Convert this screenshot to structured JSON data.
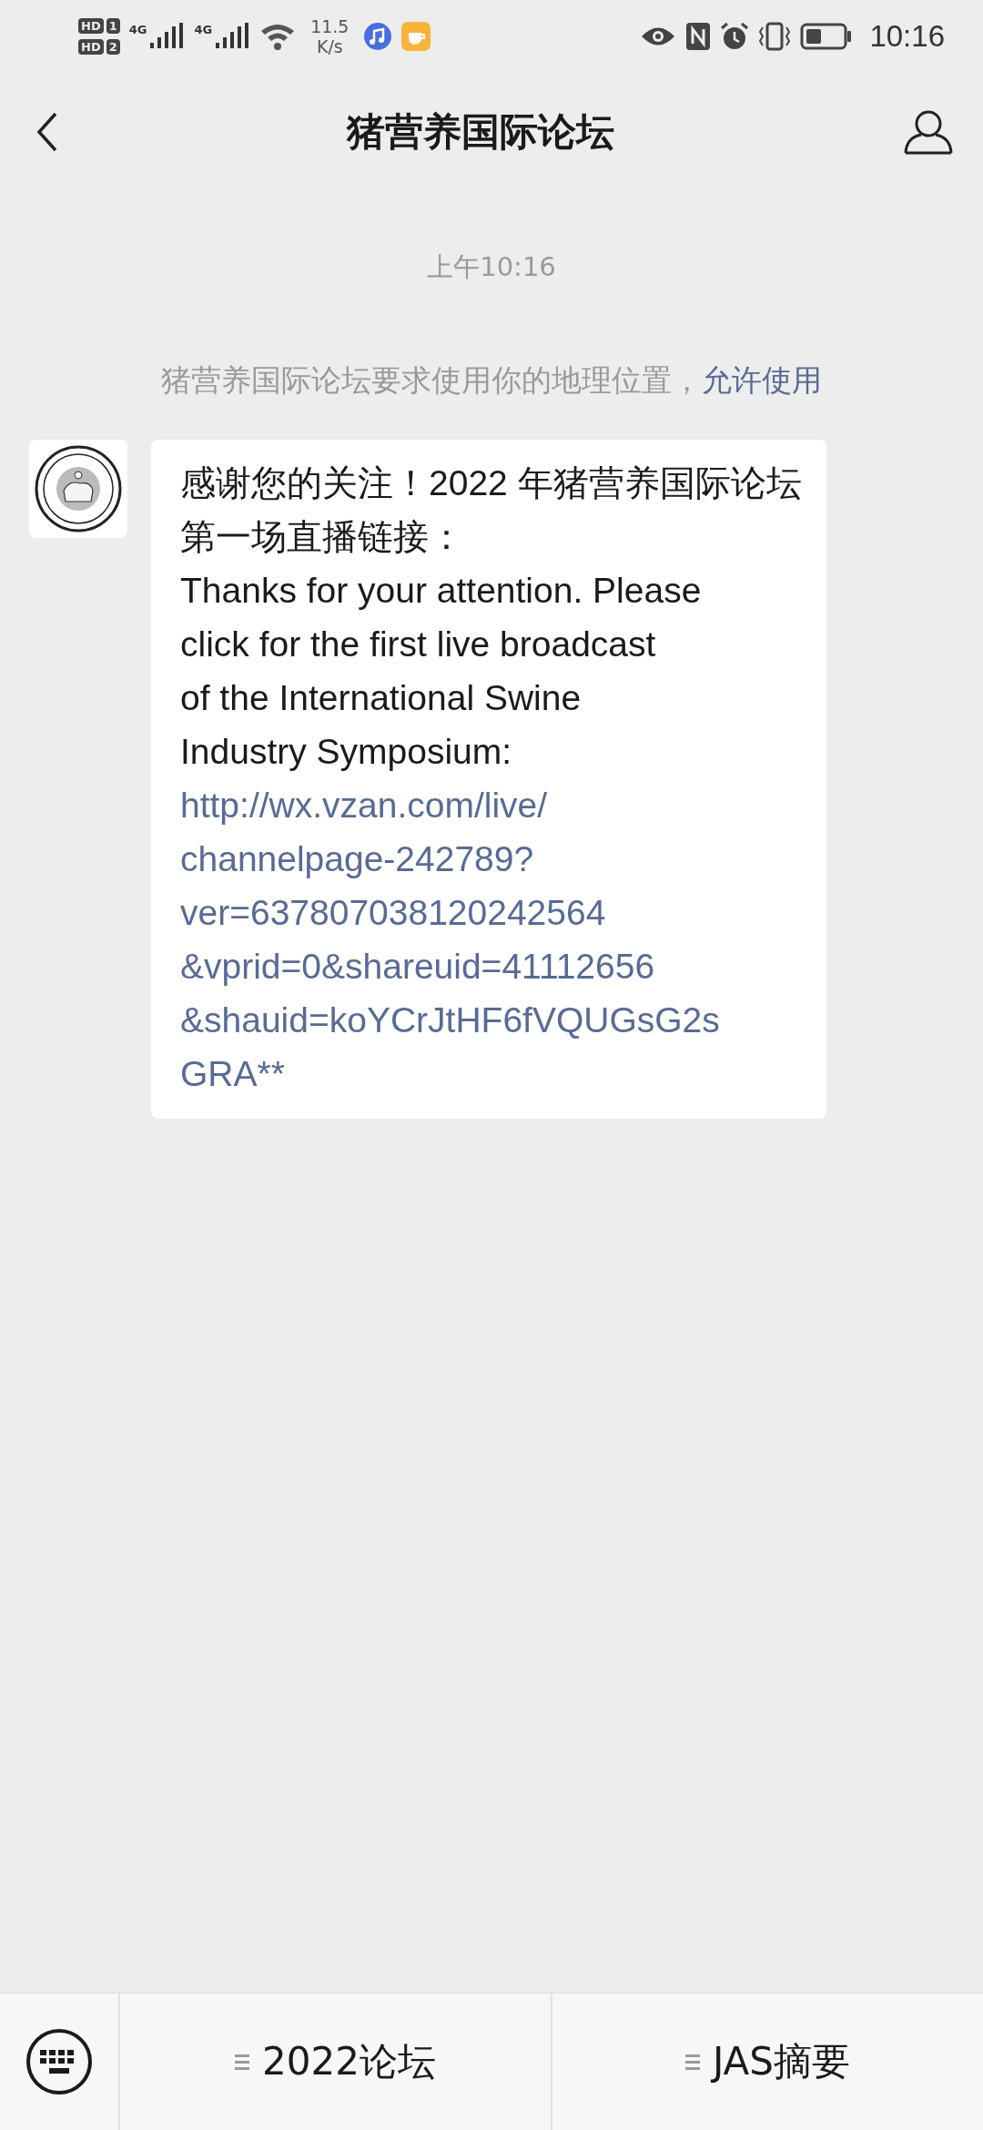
{
  "status_bar": {
    "sim_labels": [
      {
        "hd": "HD",
        "slot": "1"
      },
      {
        "hd": "HD",
        "slot": "2"
      }
    ],
    "networks": [
      "4G",
      "4G"
    ],
    "speed": "11.5",
    "speed_unit": "K/s",
    "time": "10:16"
  },
  "header": {
    "title": "猪营养国际论坛"
  },
  "chat": {
    "timestamp": "上午10:16",
    "notice": {
      "text": "猪营养国际论坛要求使用你的地理位置，",
      "action": "允许使用"
    },
    "messages": [
      {
        "text": "感谢您的关注！2022 年猪营养国际论坛第一场直播链接：\nThanks for your attention. Please\nclick for the first live broadcast\nof the International Swine\nIndustry Symposium:",
        "link": "http://wx.vzan.com/live/\nchannelpage-242789?\nver=637807038120242564\n&vprid=0&shareuid=41112656\n&shauid=koYCrJtHF6fVQUGsG2s\nGRA**"
      }
    ]
  },
  "menu_bar": {
    "items": [
      {
        "label": "2022论坛"
      },
      {
        "label": "JAS摘要"
      }
    ]
  }
}
